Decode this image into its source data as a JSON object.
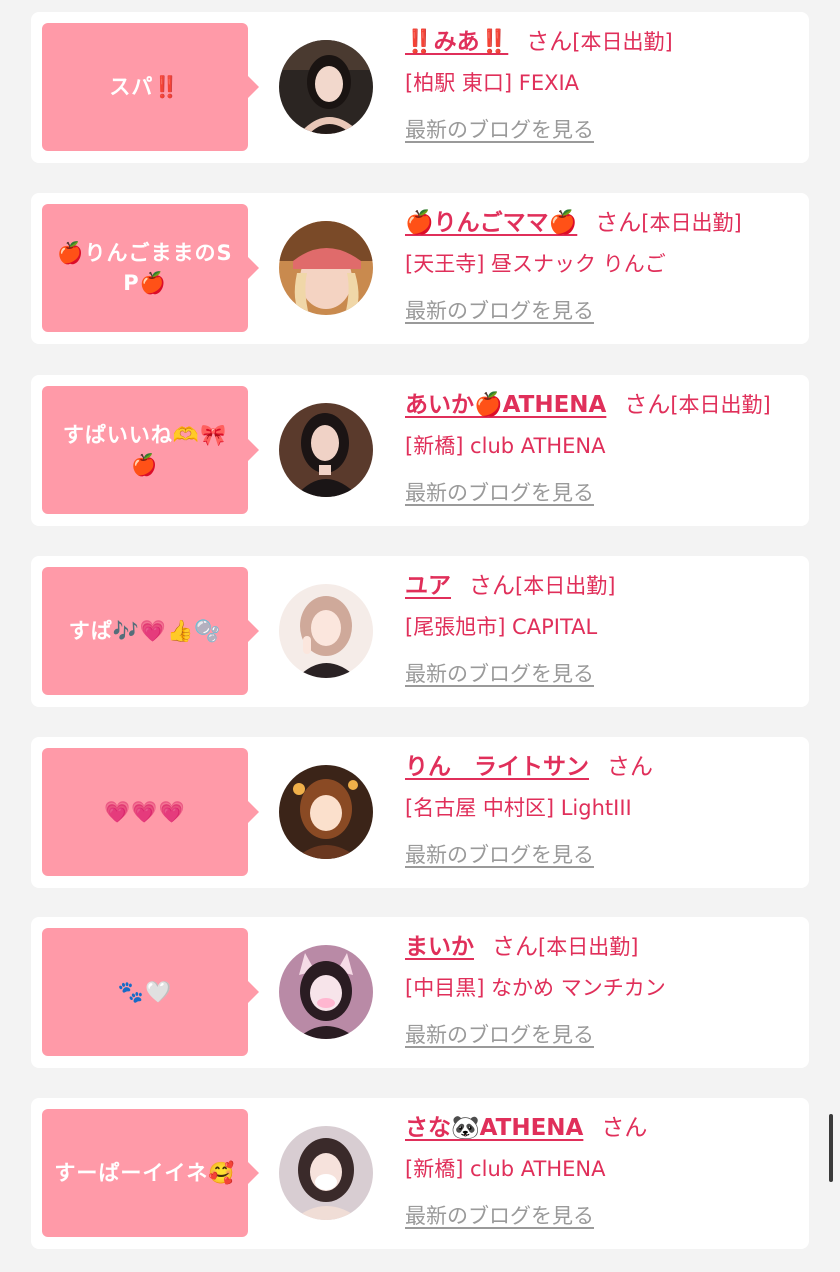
{
  "blog_link_label": "最新のブログを見る",
  "san_label": "さん",
  "colors": {
    "page_bg": "#f3f3f3",
    "card_bg": "#ffffff",
    "bubble_bg": "#ff9aa8",
    "name_pink": "#e02f5a",
    "blog_link_gray": "#9a9a9a"
  },
  "cards": [
    {
      "bubble_text": "スパ‼️",
      "name": "‼️みあ‼️",
      "attendance": "[本日出勤]",
      "shop": "[柏駅 東口] FEXIA",
      "avatar_icon": "woman-portrait-dark-hair"
    },
    {
      "bubble_text": "🍎りんごままのSP🍎",
      "name": "🍎りんごママ🍎",
      "attendance": "[本日出勤]",
      "shop": "[天王寺] 昼スナック りんご",
      "avatar_icon": "woman-portrait-pink-cap"
    },
    {
      "bubble_text": "すぱいいね🫶🎀🍎",
      "name": "あいか🍎ATHENA",
      "attendance": "[本日出勤]",
      "shop": "[新橋] club ATHENA",
      "avatar_icon": "woman-portrait-dark-dress"
    },
    {
      "bubble_text": "すぱ🎶💗👍🫧",
      "name": "ユア",
      "attendance": "[本日出勤]",
      "shop": "[尾張旭市] CAPITAL",
      "avatar_icon": "woman-portrait-peace-sign"
    },
    {
      "bubble_text": "💗💗💗",
      "name": "りん　ライトサン",
      "attendance": "",
      "shop": "[名古屋 中村区] LightIII",
      "avatar_icon": "anime-girl-portrait"
    },
    {
      "bubble_text": "🐾🤍",
      "name": "まいか",
      "attendance": "[本日出勤]",
      "shop": "[中目黒] なかめ マンチカン",
      "avatar_icon": "woman-portrait-cat-ears"
    },
    {
      "bubble_text": "すーぱーイイネ🥰",
      "name": "さな🐼ATHENA",
      "attendance": "",
      "shop": "[新橋] club ATHENA",
      "avatar_icon": "woman-portrait-mask"
    }
  ]
}
